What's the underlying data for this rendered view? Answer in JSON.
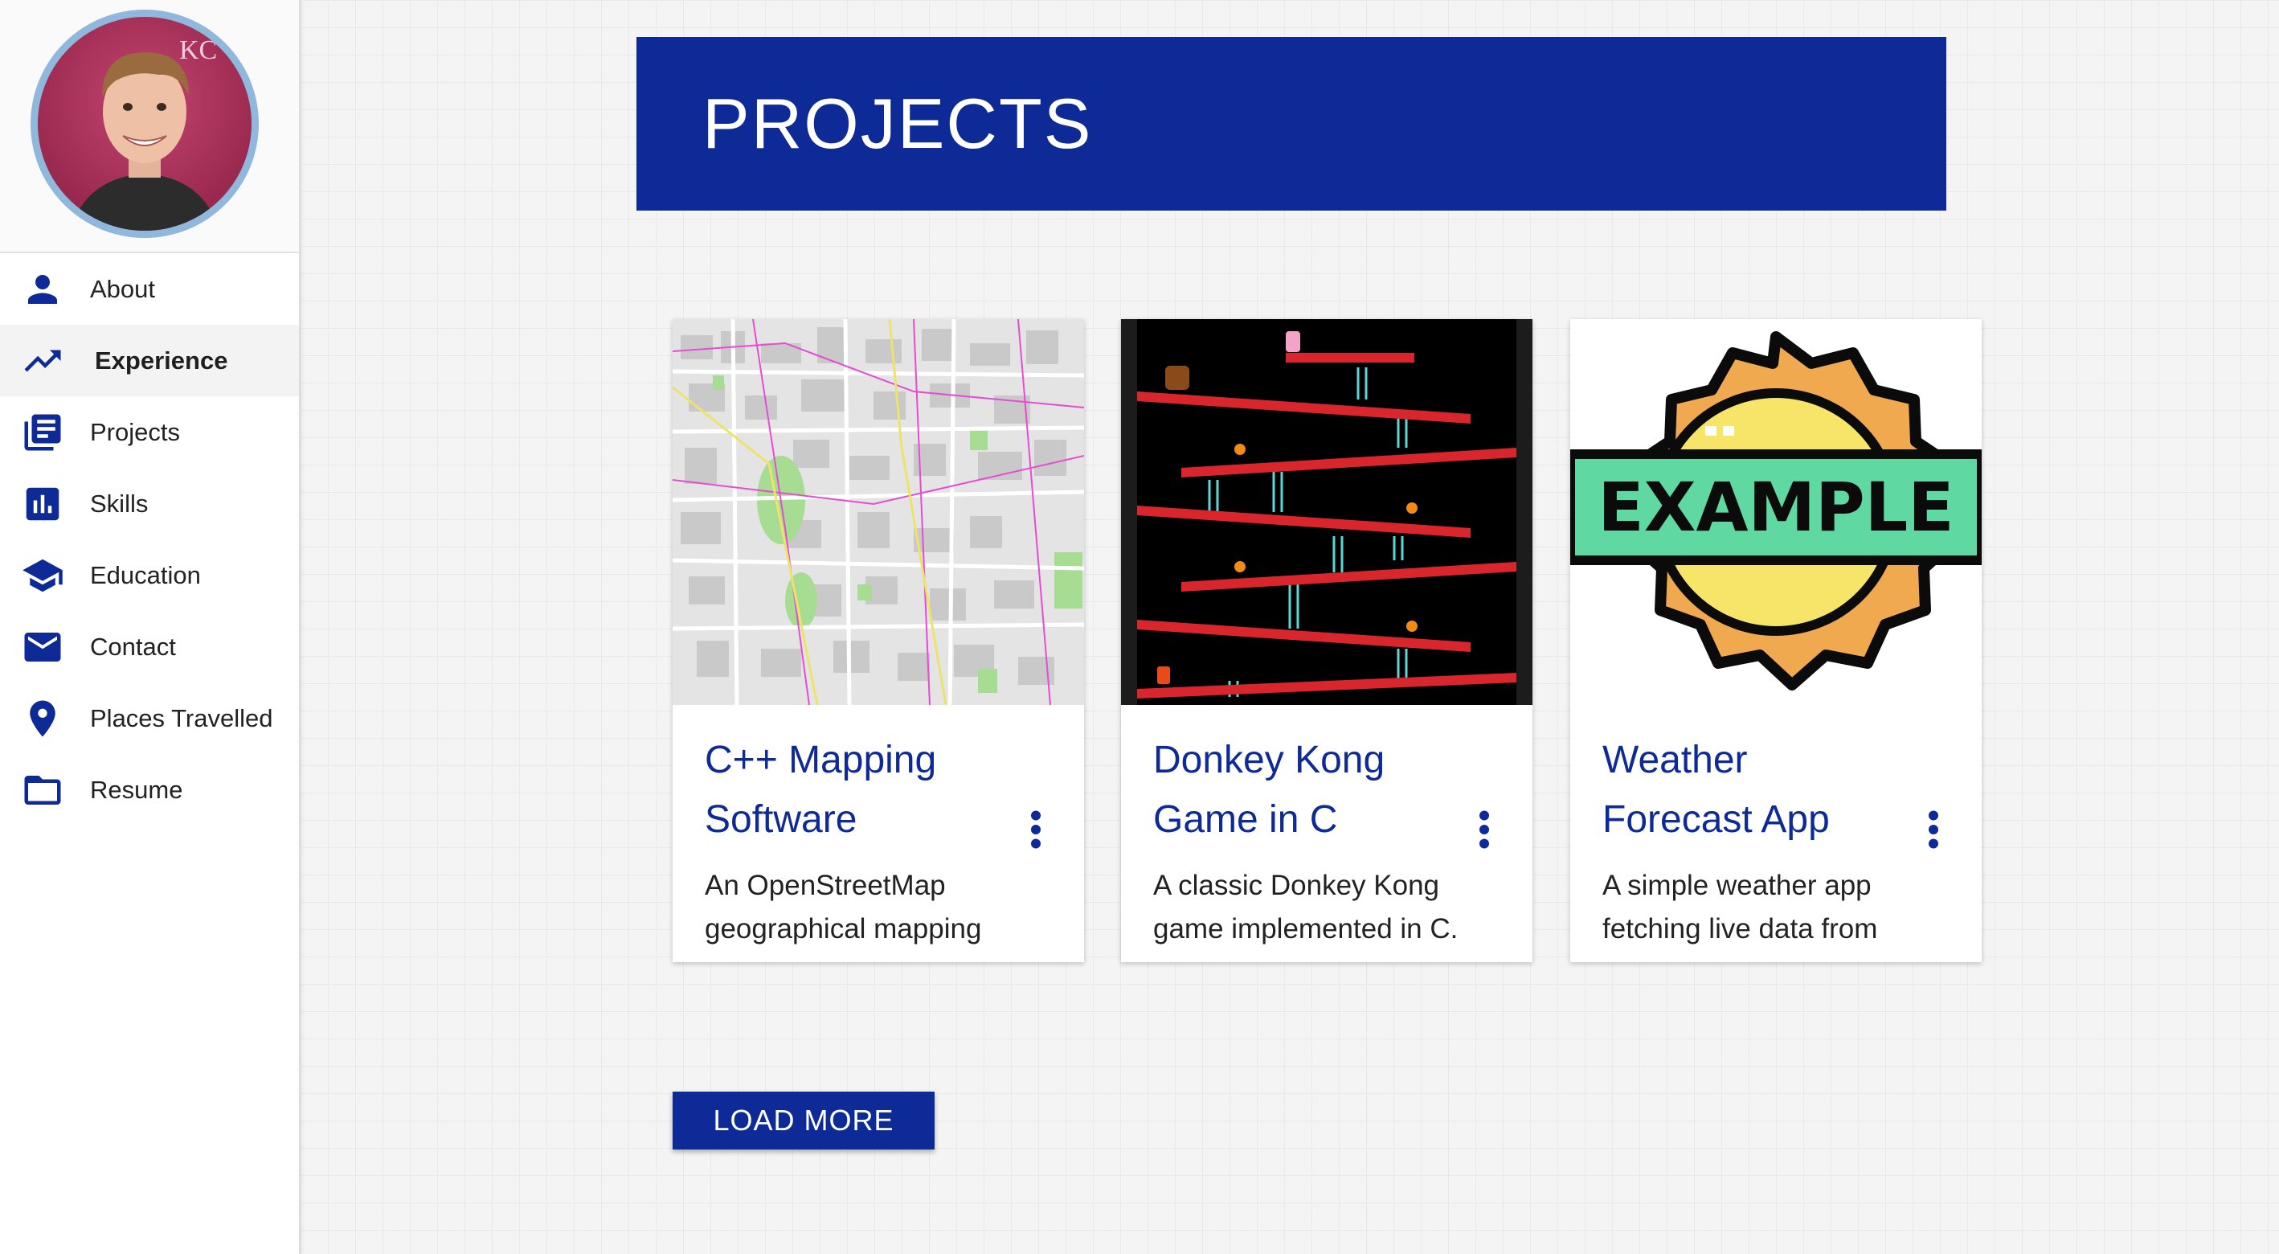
{
  "colors": {
    "primary": "#0d2a96",
    "sidebar_bg": "#ffffff",
    "page_bg": "#f4f4f4"
  },
  "sidebar": {
    "avatar": {
      "icon": "profile-photo"
    },
    "items": [
      {
        "label": "About",
        "icon": "person-icon",
        "active": false
      },
      {
        "label": "Experience",
        "icon": "trending-up-icon",
        "active": true
      },
      {
        "label": "Projects",
        "icon": "library-books-icon",
        "active": false
      },
      {
        "label": "Skills",
        "icon": "bar-chart-icon",
        "active": false
      },
      {
        "label": "Education",
        "icon": "school-icon",
        "active": false
      },
      {
        "label": "Contact",
        "icon": "mail-icon",
        "active": false
      },
      {
        "label": "Places Travelled",
        "icon": "location-pin-icon",
        "active": false
      },
      {
        "label": "Resume",
        "icon": "folder-icon",
        "active": false
      }
    ]
  },
  "header": {
    "title": "PROJECTS"
  },
  "projects": [
    {
      "title": "C++ Mapping Software",
      "description": "An OpenStreetMap geographical mapping",
      "image": "city-map-image"
    },
    {
      "title": "Donkey Kong Game in C",
      "description": "A classic Donkey Kong game implemented in C.",
      "image": "donkey-kong-screenshot"
    },
    {
      "title": "Weather Forecast App",
      "description": "A simple weather app fetching live data from",
      "image": "example-badge-image",
      "badge_text": "EXAMPLE"
    }
  ],
  "load_more_label": "LOAD MORE"
}
